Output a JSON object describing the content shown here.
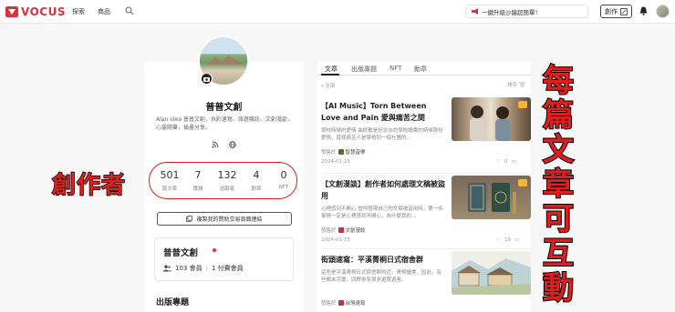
{
  "header": {
    "logo": "VOCUS",
    "nav": [
      "探索",
      "商品"
    ],
    "promo": "一鍵升級沙龍超簡單！",
    "create_label": "創作"
  },
  "profile": {
    "name": "普普文創",
    "bio": "Alan idea 普普文創，水彩速寫、旅遊雜誌、文創漫談，心靈隨筆，插畫分享。",
    "stats": [
      {
        "num": "501",
        "label": "篇文章"
      },
      {
        "num": "7",
        "label": "專題"
      },
      {
        "num": "132",
        "label": "追蹤者"
      },
      {
        "num": "4",
        "label": "勳章"
      },
      {
        "num": "0",
        "label": "NFT"
      }
    ],
    "copy_link_label": "複製我的贊助交易頁面連結",
    "member": {
      "title": "普普文創",
      "members": "103 會員",
      "paid": "1 付費會員"
    },
    "section_title": "出版專題"
  },
  "annotations": {
    "left": "創作者",
    "right": [
      "每",
      "篇",
      "文",
      "章",
      "可",
      "互",
      "動"
    ]
  },
  "feed": {
    "tabs": [
      "文章",
      "出版專題",
      "NFT",
      "勳章"
    ],
    "filter": "全部",
    "sort_label": "排序",
    "articles": [
      {
        "title": "【AI Music】Torn Between Love and Pain 愛與痛苦之間",
        "excerpt": "學校時候的愛情 曲終散是紀念似的學校讀書的時候那份愛情，曾經痛苦人是學校同一個社團的…",
        "author": "發售於",
        "category": "智慧音樂",
        "date": "2024-01-15",
        "likes": "0"
      },
      {
        "title": "【文創漫談】創作者如何處理文稿被盜用",
        "excerpt": "心裡感到不開心 當你發現自己的文章被盜用時，第一件事情一定是心裡感到不開心，為什麼我的…",
        "author": "發售於",
        "category": "文創漫談",
        "date": "2024-01-15",
        "likes": "19"
      },
      {
        "title": "街頭速寫：平溪菁桐日式宿舍群",
        "excerpt": "這些是平溪菁桐日式宿舍群的近，菁桐優美，因此，有些都未完畫，四野會有很多遊覽遊客。",
        "author": "發售於",
        "category": "台灣速寫",
        "date": "",
        "likes": ""
      }
    ]
  },
  "colors": {
    "brand": "#e0303a",
    "annotation": "#e01e1e"
  }
}
